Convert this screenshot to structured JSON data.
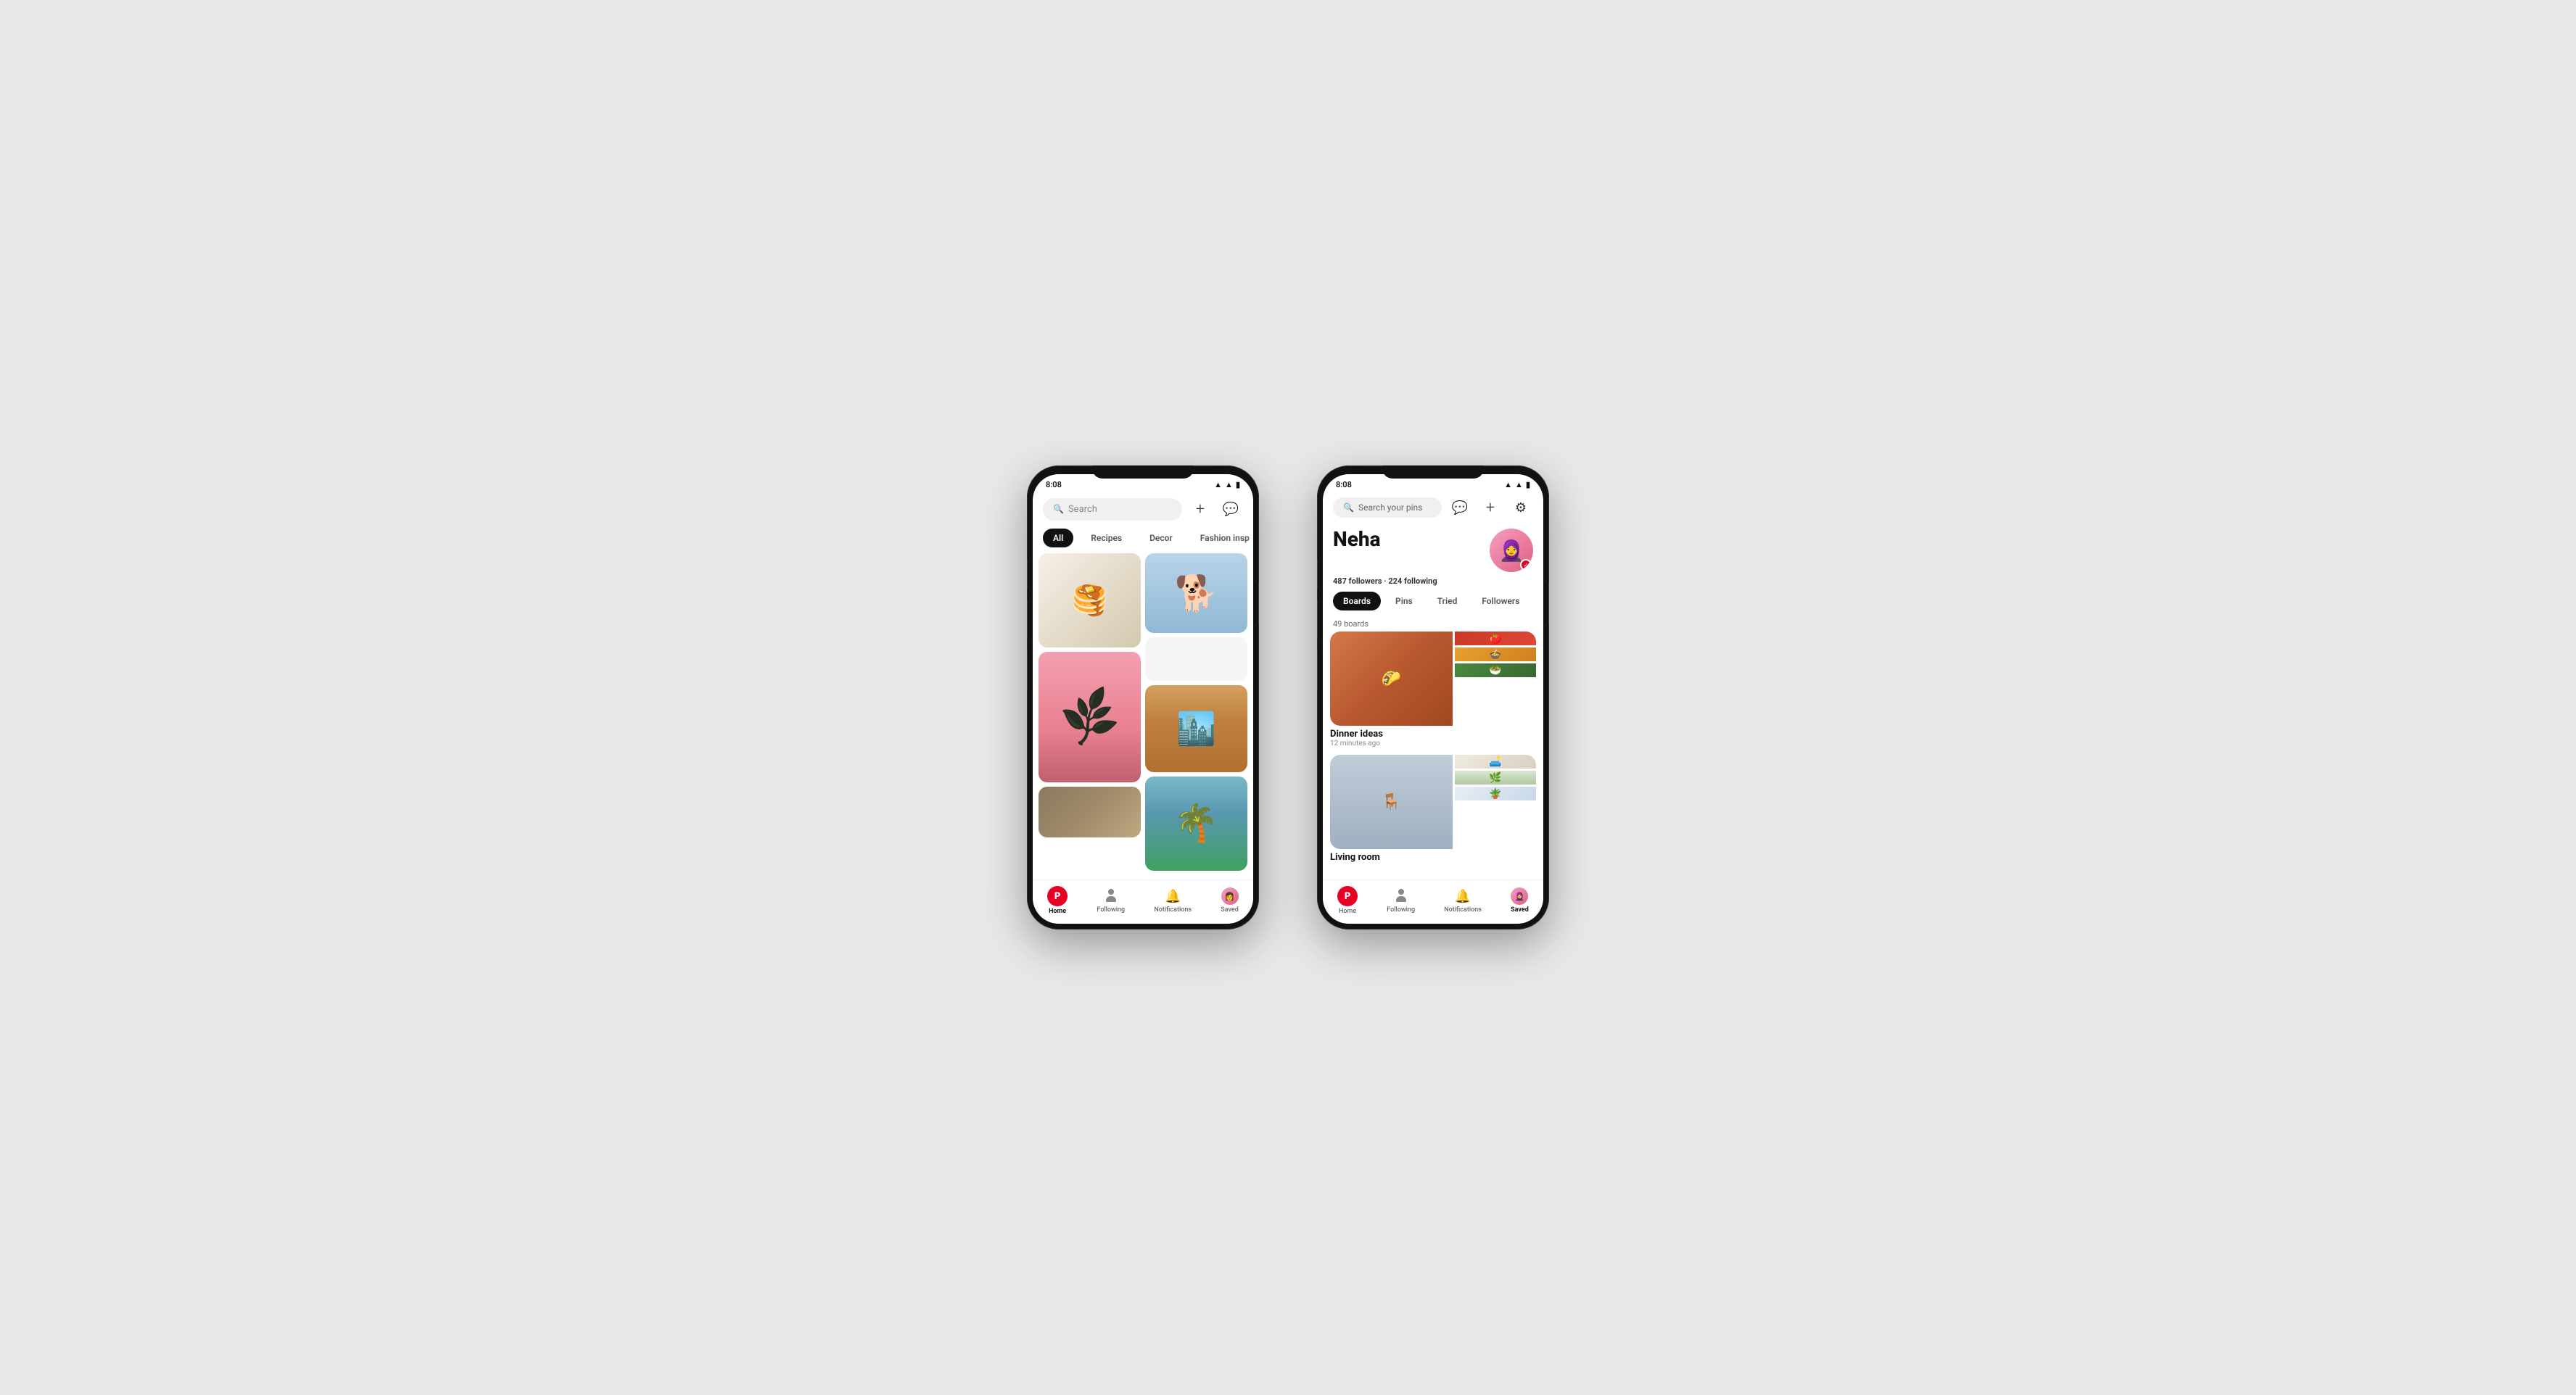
{
  "page": {
    "background": "#e8e8e8"
  },
  "phone1": {
    "status_time": "8:08",
    "search_placeholder": "Search",
    "categories": [
      "All",
      "Recipes",
      "Decor",
      "Fashion insp"
    ],
    "active_category": "All",
    "nav": {
      "home": "Home",
      "following": "Following",
      "notifications": "Notifications",
      "saved": "Saved"
    }
  },
  "phone2": {
    "status_time": "8:08",
    "search_placeholder": "Search your pins",
    "profile": {
      "name": "Neha",
      "followers": "487 followers",
      "dot": "·",
      "following_count": "224 following",
      "boards_count": "49 boards",
      "board1_name": "Dinner ideas",
      "board1_time": "12 minutes ago",
      "board2_name": "Living room",
      "board2_partial": true
    },
    "profile_tabs": [
      "Boards",
      "Pins",
      "Tried",
      "Followers"
    ],
    "active_tab": "Boards",
    "nav": {
      "home": "Home",
      "following": "Following",
      "notifications": "Notifications",
      "saved": "Saved"
    }
  }
}
